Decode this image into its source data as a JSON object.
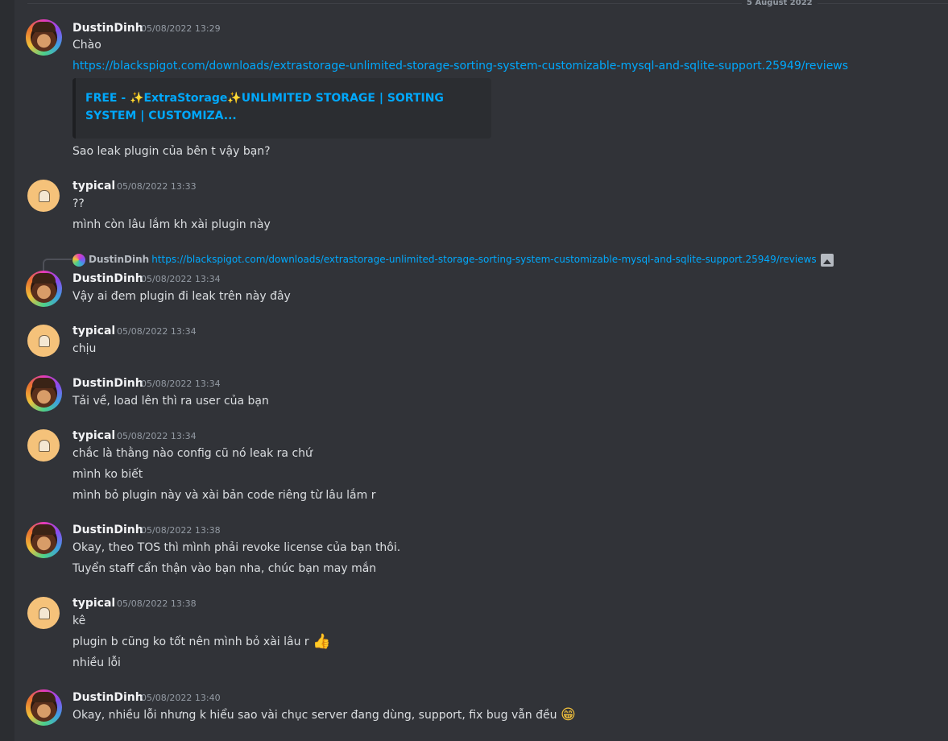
{
  "date_divider": "5 August 2022",
  "messages": [
    {
      "user": "DustinDinh",
      "ts": "05/08/2022 13:29",
      "lines": [
        "Chào",
        "https://blackspigot.com/downloads/extrastorage-unlimited-storage-sorting-system-customizable-mysql-and-sqlite-support.25949/reviews"
      ],
      "embed_title": "FREE - ✨ExtraStorage✨UNLIMITED STORAGE | SORTING SYSTEM | CUSTOMIZA...",
      "after": "Sao leak plugin của bên t vậy bạn?"
    },
    {
      "user": "typical",
      "ts": "05/08/2022 13:33",
      "lines": [
        "??",
        "mình còn lâu lắm kh xài plugin này"
      ]
    },
    {
      "user": "DustinDinh",
      "ts": "05/08/2022 13:34",
      "reply_user": "DustinDinh",
      "reply_text": "https://blackspigot.com/downloads/extrastorage-unlimited-storage-sorting-system-customizable-mysql-and-sqlite-support.25949/reviews",
      "lines": [
        "Vậy ai đem plugin đi leak trên này đây"
      ]
    },
    {
      "user": "typical",
      "ts": "05/08/2022 13:34",
      "lines": [
        "chịu"
      ]
    },
    {
      "user": "DustinDinh",
      "ts": "05/08/2022 13:34",
      "lines": [
        "Tải về, load lên thì ra user của bạn"
      ]
    },
    {
      "user": "typical",
      "ts": "05/08/2022 13:34",
      "lines": [
        "chắc là thằng nào config cũ nó leak ra chứ",
        "mình ko biết",
        "mình bỏ plugin này và xài bản code riêng từ lâu lắm r"
      ]
    },
    {
      "user": "DustinDinh",
      "ts": "05/08/2022 13:38",
      "lines": [
        "Okay, theo TOS thì mình phải revoke license của bạn thôi.",
        "Tuyển staff cẩn thận vào bạn nha, chúc bạn may mắn"
      ]
    },
    {
      "user": "typical",
      "ts": "05/08/2022 13:38",
      "lines": [
        "kê",
        "plugin b cũng ko tốt nên mình bỏ xài lâu r",
        "nhiều lỗi"
      ],
      "emoji": "👍"
    },
    {
      "user": "DustinDinh",
      "ts": "05/08/2022 13:40",
      "lines": [
        "Okay, nhiều lỗi nhưng k hiểu sao vài chục server đang dùng, support, fix bug vẫn đều"
      ],
      "emoji": "😁"
    }
  ]
}
